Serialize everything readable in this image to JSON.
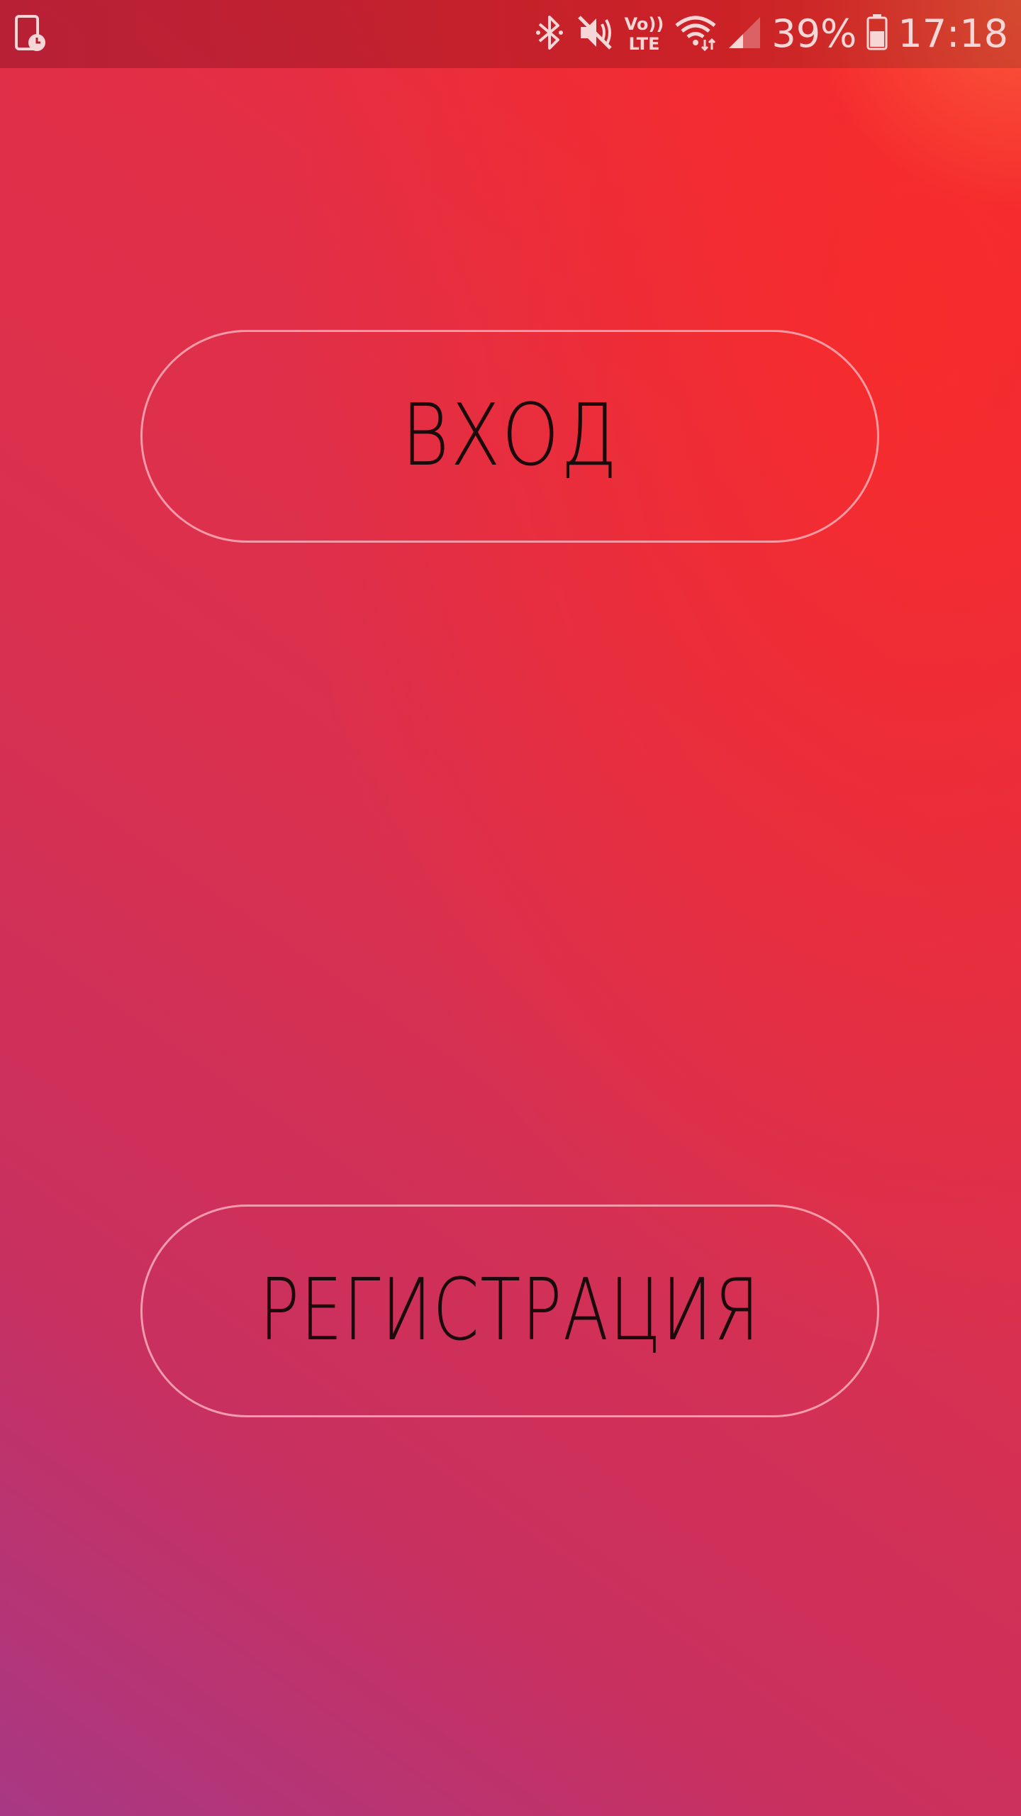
{
  "status_bar": {
    "battery_percent": "39%",
    "time": "17:18",
    "volte_top": "Vo))",
    "volte_bottom": "LTE",
    "icons": [
      "screenshot-schedule-icon",
      "bluetooth-icon",
      "mute-icon",
      "volte-icon",
      "wifi-icon",
      "signal-icon",
      "battery-icon"
    ]
  },
  "buttons": {
    "login_label": "ВХОД",
    "register_label": "РЕГИСТРАЦИЯ"
  },
  "colors": {
    "top_right": "#f52b30",
    "bottom_left": "#a83884",
    "button_border": "#f5b4c0",
    "button_text": "#1a0a0c"
  }
}
